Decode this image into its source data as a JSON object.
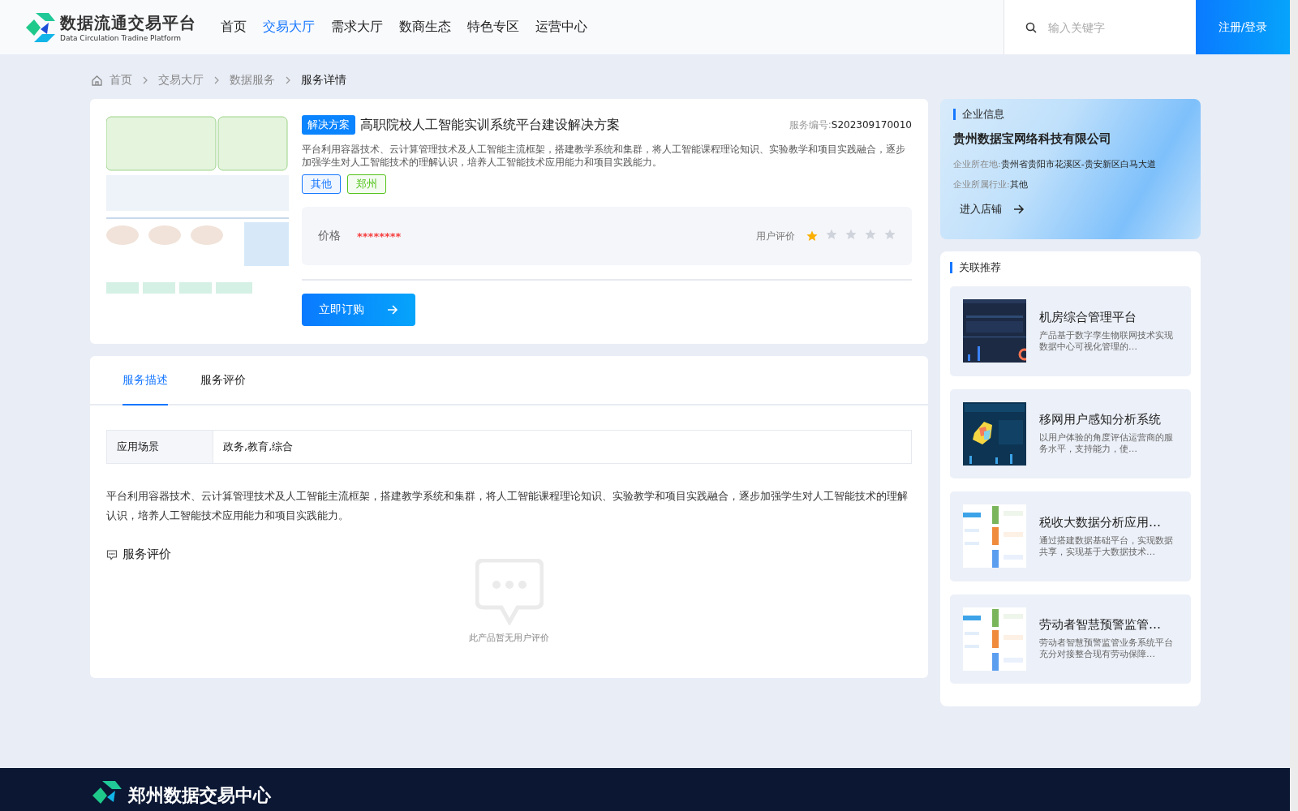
{
  "header": {
    "logo_title": "数据流通交易平台",
    "logo_subtitle": "Data Circulation Tradine Platform",
    "nav": [
      {
        "label": "首页",
        "selected": false
      },
      {
        "label": "交易大厅",
        "selected": true
      },
      {
        "label": "需求大厅",
        "selected": false
      },
      {
        "label": "数商生态",
        "selected": false
      },
      {
        "label": "特色专区",
        "selected": false
      },
      {
        "label": "运营中心",
        "selected": false
      }
    ],
    "search": {
      "placeholder": "输入关键字"
    },
    "login_button": "注册/登录"
  },
  "breadcrumb": [
    "首页",
    "交易大厅",
    "数据服务",
    "服务详情"
  ],
  "product": {
    "badge": "解决方案",
    "title": "高职院校人工智能实训系统平台建设解决方案",
    "code_label": "服务编号:",
    "code": "S202309170010",
    "description": "平台利用容器技术、云计算管理技术及人工智能主流框架，搭建教学系统和集群，将人工智能课程理论知识、实验教学和项目实践融合，逐步加强学生对人工智能技术的理解认识，培养人工智能技术应用能力和项目实践能力。",
    "tags": [
      {
        "label": "其他",
        "color": "#1677ff"
      },
      {
        "label": "郑州",
        "color": "#52c41a"
      }
    ],
    "price_label": "价格",
    "price": "********",
    "rating_label": "用户评价",
    "stars": 1,
    "order_button": "立即订购"
  },
  "detail": {
    "tabs": [
      {
        "label": "服务描述",
        "selected": true
      },
      {
        "label": "服务评价",
        "selected": false
      }
    ],
    "attributes": [
      {
        "name": "应用场景",
        "value": "政务,教育,综合"
      }
    ],
    "description": "平台利用容器技术、云计算管理技术及人工智能主流框架，搭建教学系统和集群，将人工智能课程理论知识、实验教学和项目实践融合，逐步加强学生对人工智能技术的理解认识，培养人工智能技术应用能力和项目实践能力。",
    "review_heading": "服务评价",
    "empty_text": "此产品暂无用户评价"
  },
  "company": {
    "heading": "企业信息",
    "name": "贵州数据宝网络科技有限公司",
    "fields": [
      {
        "label": "企业所在地:",
        "value": "贵州省贵阳市花溪区-贵安新区白马大道"
      },
      {
        "label": "企业所属行业:",
        "value": "其他"
      }
    ],
    "shop_link": "进入店铺"
  },
  "related": {
    "heading": "关联推荐",
    "items": [
      {
        "title": "机房综合管理平台",
        "summary": "产品基于数字孪生物联网技术实现数据中心可视化管理的…",
        "kind": "dark"
      },
      {
        "title": "移网用户感知分析系统",
        "summary": "以用户体验的角度评估运营商的服务水平，支持能力，使…",
        "kind": "map"
      },
      {
        "title": "税收大数据分析应用…",
        "summary": "通过搭建数据基础平台，实现数据共享，实现基于大数据技术…",
        "kind": "light"
      },
      {
        "title": "劳动者智慧预警监管…",
        "summary": "劳动者智慧预警监管业务系统平台充分对接整合现有劳动保障…",
        "kind": "light"
      }
    ]
  },
  "footer": {
    "logo_title": "郑州数据交易中心"
  }
}
